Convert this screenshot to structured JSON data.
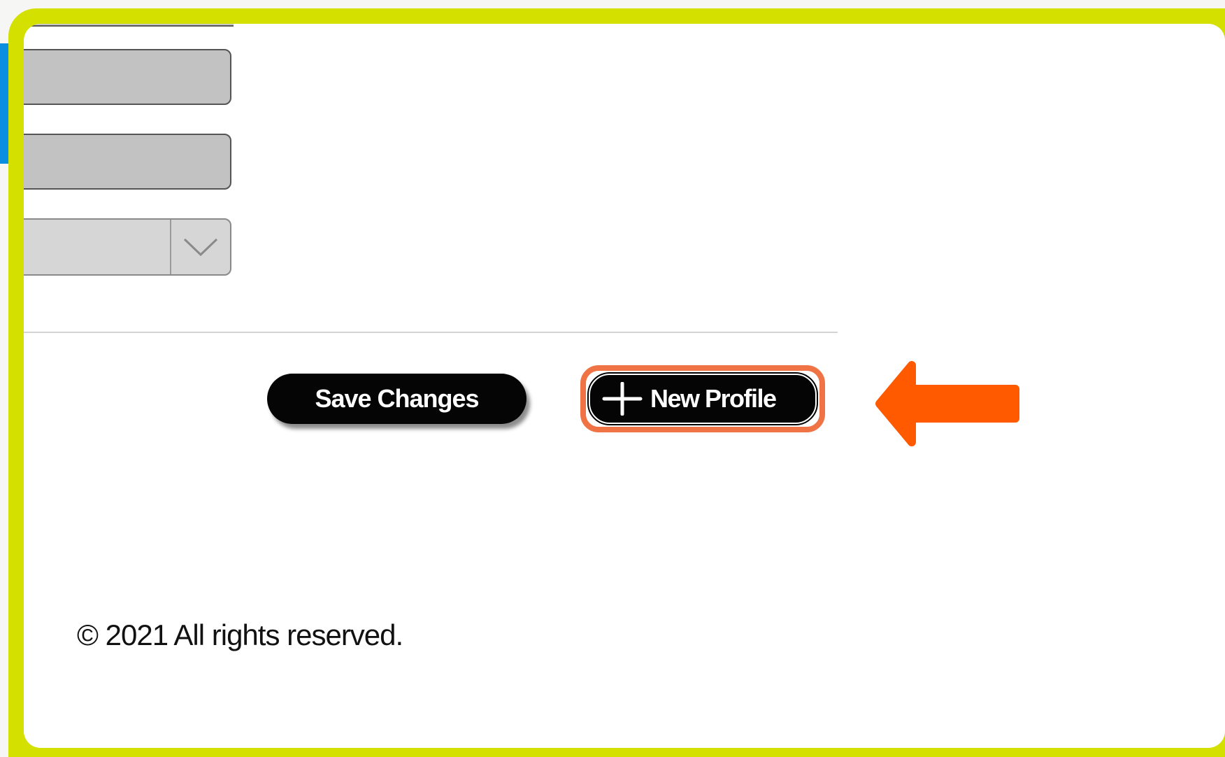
{
  "form": {
    "field_1_value": "",
    "field_2_value": "",
    "select_value": ""
  },
  "actions": {
    "save_label": "Save Changes",
    "new_profile_label": "New Profile"
  },
  "footer": {
    "copyright": "© 2021 All rights reserved."
  },
  "annotation": {
    "highlight_color": "#f07346",
    "arrow_color": "#ff5a00",
    "frame_color": "#d3e000"
  },
  "icons": {
    "dropdown": "chevron-down-icon",
    "new_profile": "plus-icon",
    "pointer": "arrow-left-icon"
  }
}
